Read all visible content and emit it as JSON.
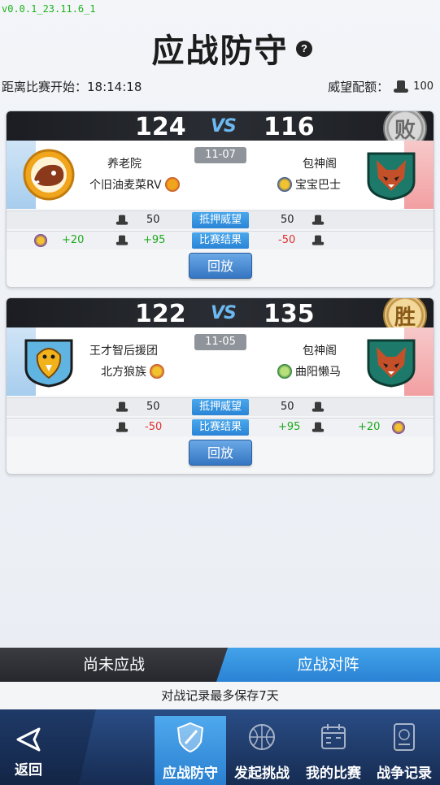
{
  "version": "v0.0.1_23.11.6_1",
  "page_title": "应战防守",
  "help_icon": "question-icon",
  "countdown": "距离比赛开始：18:14:18",
  "prestige": {
    "label": "威望配额：",
    "value": "100",
    "icon": "hat-icon"
  },
  "matches": [
    {
      "score_left": "124",
      "score_right": "116",
      "vs": "VS",
      "result": "败",
      "result_type": "lose",
      "date": "11-07",
      "left_team": "养老院",
      "left_player": "个旧油麦菜RV",
      "right_team": "包神阁",
      "right_player": "宝宝巴士",
      "stake_label": "抵押威望",
      "stake_left": "50",
      "stake_right": "50",
      "result_label": "比赛结果",
      "result_left_bonus": "+20",
      "result_left": "+95",
      "result_right": "-50",
      "result_right_bonus": "",
      "replay": "回放"
    },
    {
      "score_left": "122",
      "score_right": "135",
      "vs": "VS",
      "result": "胜",
      "result_type": "win",
      "date": "11-05",
      "left_team": "王才智后援团",
      "left_player": "北方狼族",
      "right_team": "包神阁",
      "right_player": "曲阳懒马",
      "stake_label": "抵押威望",
      "stake_left": "50",
      "stake_right": "50",
      "result_label": "比赛结果",
      "result_left_bonus": "",
      "result_left": "-50",
      "result_right": "+95",
      "result_right_bonus": "+20",
      "replay": "回放"
    }
  ],
  "tabs": [
    {
      "label": "尚未应战",
      "active": false
    },
    {
      "label": "应战对阵",
      "active": true
    }
  ],
  "footnote": "对战记录最多保存7天",
  "bottom_nav": {
    "back": "返回",
    "items": [
      {
        "label": "应战防守",
        "icon": "shield-icon",
        "active": true
      },
      {
        "label": "发起挑战",
        "icon": "basketball-icon",
        "active": false
      },
      {
        "label": "我的比赛",
        "icon": "calendar-icon",
        "active": false
      },
      {
        "label": "战争记录",
        "icon": "record-book-icon",
        "active": false
      }
    ]
  },
  "colors": {
    "accent": "#2a84d6",
    "win": "#1ea91e",
    "lose": "#e03030"
  }
}
